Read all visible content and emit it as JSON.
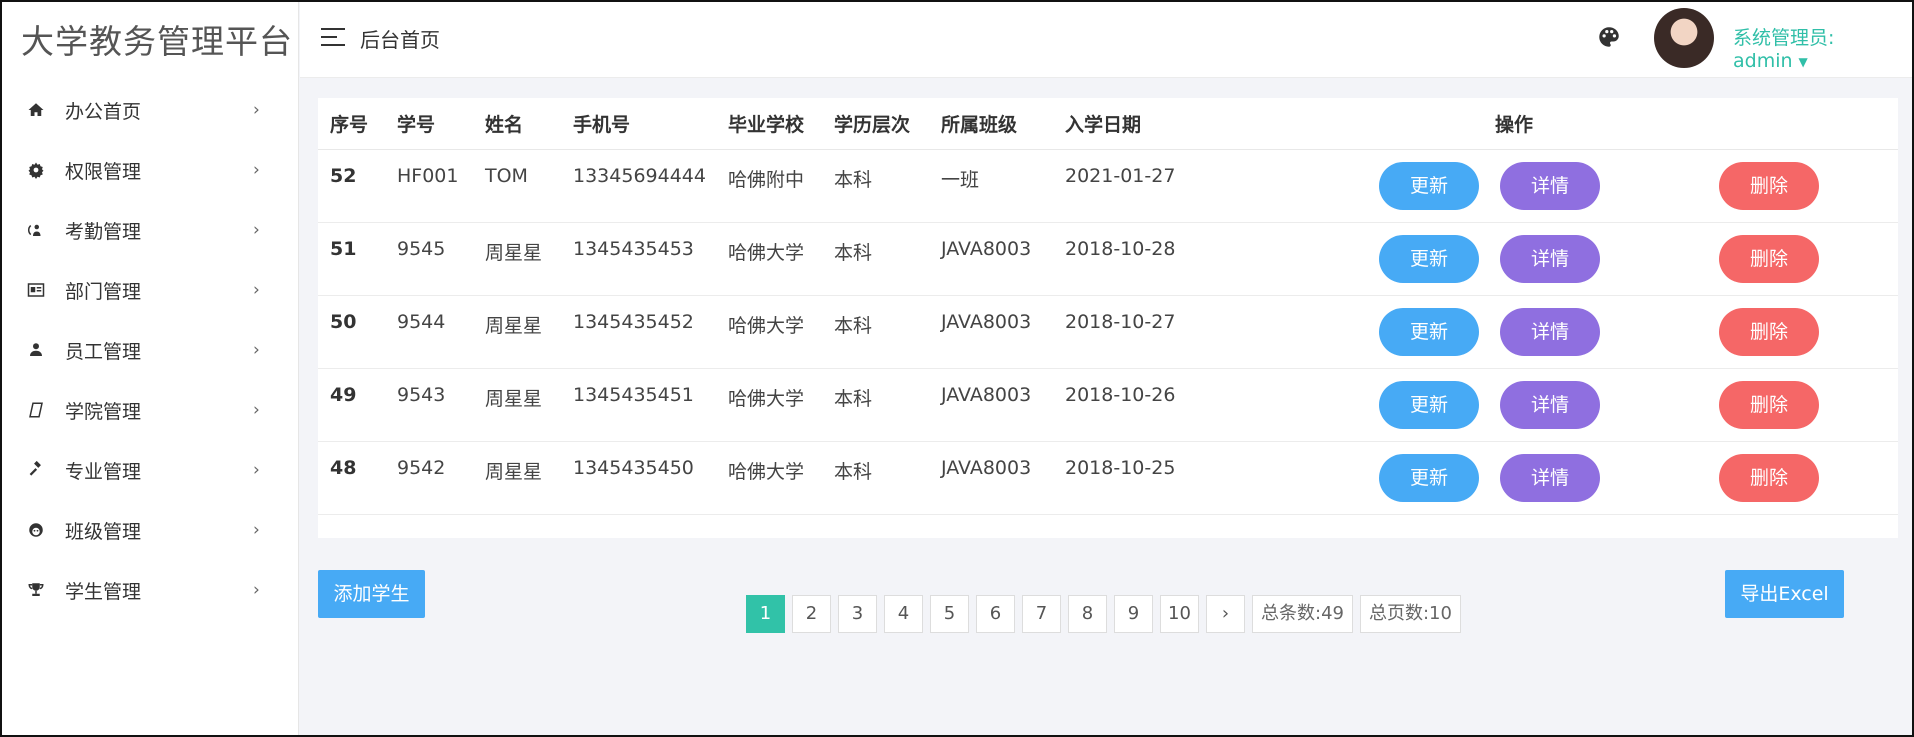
{
  "brand": "大学教务管理平台",
  "header": {
    "title": "后台首页",
    "user": "系统管理员: admin",
    "palette_icon": "palette-icon"
  },
  "sidebar": {
    "items": [
      {
        "label": "办公首页",
        "icon": "home-icon"
      },
      {
        "label": "权限管理",
        "icon": "gear-icon"
      },
      {
        "label": "考勤管理",
        "icon": "person-refresh-icon"
      },
      {
        "label": "部门管理",
        "icon": "id-card-icon"
      },
      {
        "label": "员工管理",
        "icon": "user-icon"
      },
      {
        "label": "学院管理",
        "icon": "book-icon"
      },
      {
        "label": "专业管理",
        "icon": "gavel-icon"
      },
      {
        "label": "班级管理",
        "icon": "face-icon"
      },
      {
        "label": "学生管理",
        "icon": "trophy-icon"
      }
    ]
  },
  "table": {
    "headers": [
      "序号",
      "学号",
      "姓名",
      "手机号",
      "毕业学校",
      "学历层次",
      "所属班级",
      "入学日期",
      "操作"
    ],
    "rows": [
      [
        "52",
        "HF001",
        "TOM",
        "13345694444",
        "哈佛附中",
        "本科",
        "一班",
        "2021-01-27"
      ],
      [
        "51",
        "9545",
        "周星星",
        "1345435453",
        "哈佛大学",
        "本科",
        "JAVA8003",
        "2018-10-28"
      ],
      [
        "50",
        "9544",
        "周星星",
        "1345435452",
        "哈佛大学",
        "本科",
        "JAVA8003",
        "2018-10-27"
      ],
      [
        "49",
        "9543",
        "周星星",
        "1345435451",
        "哈佛大学",
        "本科",
        "JAVA8003",
        "2018-10-26"
      ],
      [
        "48",
        "9542",
        "周星星",
        "1345435450",
        "哈佛大学",
        "本科",
        "JAVA8003",
        "2018-10-25"
      ]
    ],
    "actions": {
      "update": "更新",
      "detail": "详情",
      "delete": "删除"
    }
  },
  "buttons": {
    "add": "添加学生",
    "export": "导出Excel"
  },
  "pagination": {
    "pages": [
      "1",
      "2",
      "3",
      "4",
      "5",
      "6",
      "7",
      "8",
      "9",
      "10"
    ],
    "current": "1",
    "next": "›",
    "total_items": "总条数:49",
    "total_pages": "总页数:10"
  },
  "colors": {
    "accent": "#31c2a8",
    "update": "#47aaf5",
    "detail": "#8f6fe0",
    "delete": "#f56767"
  }
}
